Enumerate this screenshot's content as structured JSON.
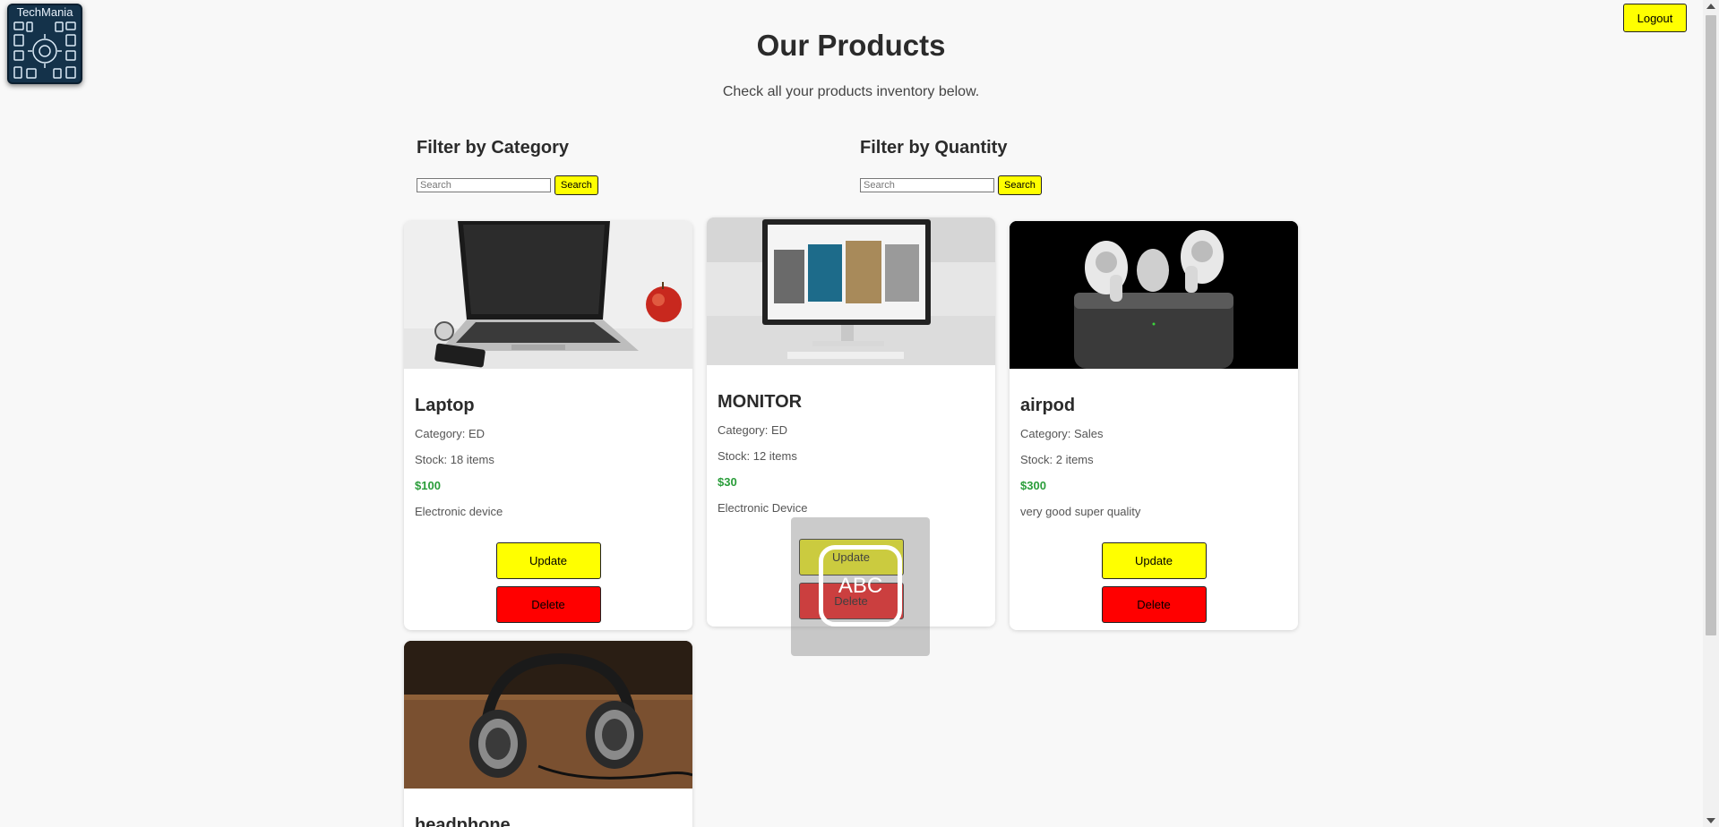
{
  "header": {
    "logo_text": "TechMania",
    "logout_label": "Logout",
    "title": "Our Products",
    "subtitle": "Check all your products inventory below."
  },
  "filters": {
    "category": {
      "heading": "Filter by Category",
      "placeholder": "Search",
      "value": "",
      "button_label": "Search"
    },
    "quantity": {
      "heading": "Filter by Quantity",
      "placeholder": "Search",
      "value": "",
      "button_label": "Search"
    }
  },
  "products": [
    {
      "name": "Laptop",
      "category": "Category: ED",
      "stock": "Stock: 18 items",
      "price": "$100",
      "description": "Electronic device",
      "update_label": "Update",
      "delete_label": "Delete",
      "image": "laptop"
    },
    {
      "name": "MONITOR",
      "category": "Category: ED",
      "stock": "Stock: 12 items",
      "price": "$30",
      "description": "Electronic Device",
      "update_label": "Update",
      "delete_label": "Delete",
      "image": "monitor"
    },
    {
      "name": "airpod",
      "category": "Category: Sales",
      "stock": "Stock: 2 items",
      "price": "$300",
      "description": "very good super quality",
      "update_label": "Update",
      "delete_label": "Delete",
      "image": "airpods"
    },
    {
      "name": "headphone",
      "image": "headphones"
    }
  ],
  "overlay": {
    "text": "ABC"
  },
  "colors": {
    "accent_yellow": "#ffff00",
    "danger_red": "#ff0000",
    "price_green": "#2a9d3a",
    "background": "#f8f8f8"
  }
}
